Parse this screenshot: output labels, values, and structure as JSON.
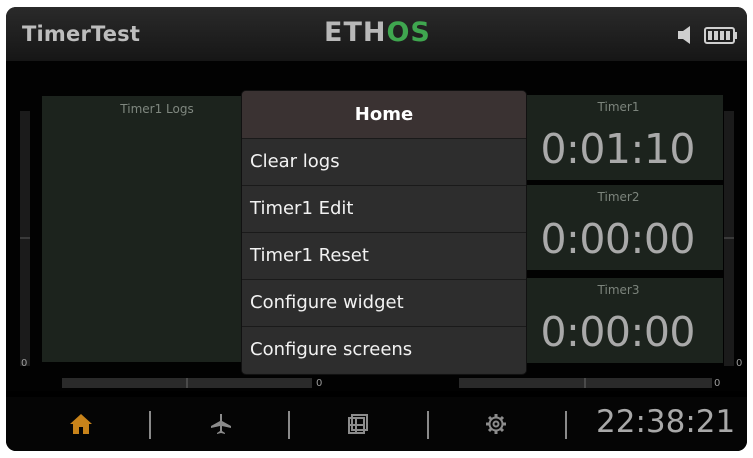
{
  "header": {
    "title": "TimerTest",
    "logo_main": "ETH",
    "logo_accent": "OS",
    "accent_color": "#3fa64f"
  },
  "widgets": {
    "logs_title": "Timer1 Logs",
    "timers": [
      {
        "label": "Timer1",
        "value": "0:01:10"
      },
      {
        "label": "Timer2",
        "value": "0:00:00"
      },
      {
        "label": "Timer3",
        "value": "0:00:00"
      }
    ],
    "rail_left_zero": "0",
    "rail_right_zero": "0",
    "bar_left_zero": "0",
    "bar_right_zero": "0"
  },
  "menu": {
    "title": "Home",
    "items": [
      "Clear logs",
      "Timer1 Edit",
      "Timer1 Reset",
      "Configure widget",
      "Configure screens"
    ]
  },
  "footer": {
    "icons": [
      "home-icon",
      "airplane-icon",
      "layout-icon",
      "gear-icon"
    ],
    "time": "22:38:21",
    "home_color": "#c8831a"
  }
}
